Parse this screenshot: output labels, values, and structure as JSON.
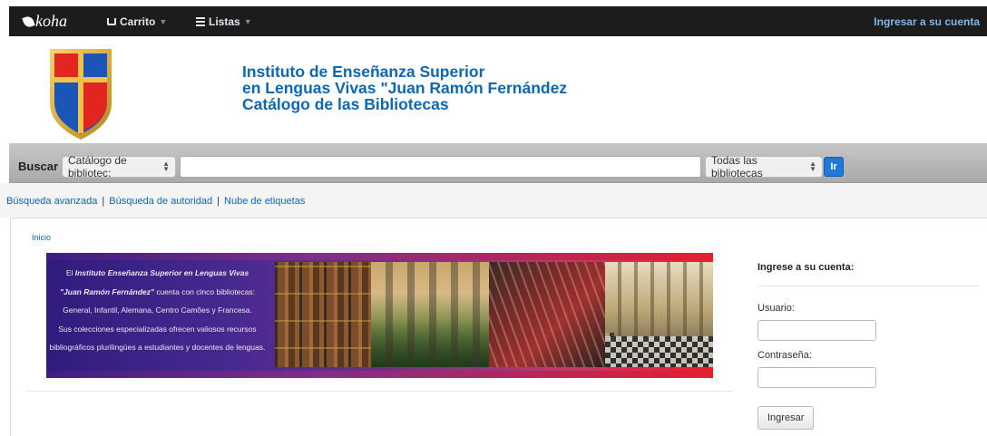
{
  "topnav": {
    "logo": "koha",
    "cart_label": "Carrito",
    "lists_label": "Listas",
    "login_link": "Ingresar a su cuenta",
    "bg_color": "#1c1c1c",
    "link_color": "#7fb6e8"
  },
  "header": {
    "title_line1": "Instituto de Enseñanza Superior",
    "title_line2": "en Lenguas Vivas \"Juan Ramón Fernández",
    "title_line3": "Catálogo de las Bibliotecas",
    "title_color": "#0d67b1",
    "logo_icon": "shield-crest-icon"
  },
  "search": {
    "label": "Buscar",
    "index_select": "Catálogo de bibliotec:",
    "query_value": "",
    "branch_select": "Todas las bibliotecas",
    "go_label": "Ir",
    "go_color": "#1f7ad6"
  },
  "links": {
    "advanced": "Búsqueda avanzada",
    "authority": "Búsqueda de autoridad",
    "tags": "Nube de etiquetas",
    "separator": "|"
  },
  "breadcrumb": {
    "home": "Inicio"
  },
  "banner": {
    "line1_prefix": "El ",
    "line1_bold": "Instituto Enseñanza Superior en Lenguas Vivas",
    "line2_bold": "\"Juan Ramón Fernández\"",
    "line2_rest": " cuenta con cinco bibliotecas:",
    "line3": "General, Infantil, Alemana, Centro Camões y Francesa.",
    "line4": "Sus colecciones especializadas ofrecen valiosos recursos",
    "line5": "bibliográficos plurilingües a estudiantes y docentes de lenguas."
  },
  "login": {
    "heading": "Ingrese a su cuenta:",
    "user_label": "Usuario:",
    "user_value": "",
    "password_label": "Contraseña:",
    "password_value": "",
    "submit_label": "Ingresar"
  }
}
